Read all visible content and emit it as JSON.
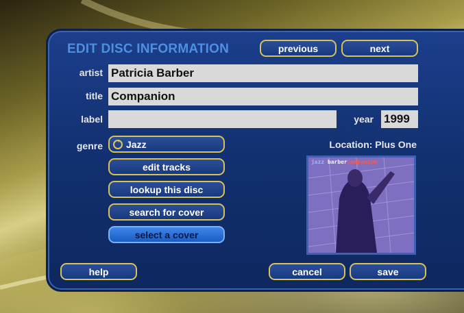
{
  "screen": {
    "title": "EDIT DISC INFORMATION",
    "previous_label": "previous",
    "next_label": "next"
  },
  "fields": {
    "artist_label": "artist",
    "artist_value": "Patricia Barber",
    "title_label": "title",
    "title_value": "Companion",
    "label_label": "label",
    "label_value": "",
    "year_label": "year",
    "year_value": "1999",
    "genre_label": "genre",
    "genre_value": "Jazz"
  },
  "actions": {
    "edit_tracks": "edit tracks",
    "lookup_disc": "lookup this disc",
    "search_cover": "search for cover",
    "select_cover": "select a cover"
  },
  "location": {
    "text": "Location: Plus One"
  },
  "cover": {
    "caption_left": "jazz",
    "caption_mid": "barber",
    "caption_right": "companion"
  },
  "footer": {
    "help_label": "help",
    "cancel_label": "cancel",
    "save_label": "save"
  },
  "colors": {
    "panel": "#12306f",
    "button_border": "#d8c25a",
    "selected_button": "#3f86e8",
    "title": "#4f8fe0"
  }
}
